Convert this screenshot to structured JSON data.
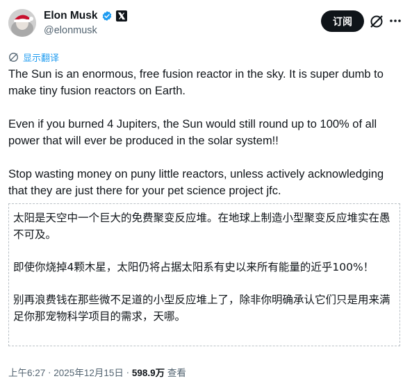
{
  "author": {
    "display_name": "Elon Musk",
    "handle": "@elonmusk"
  },
  "header": {
    "subscribe_label": "订阅"
  },
  "translate": {
    "label": "显示翻译"
  },
  "tweet": {
    "paragraphs": [
      "The Sun is an enormous, free fusion reactor in the sky. It is super dumb to make tiny fusion reactors on Earth.",
      "Even if you burned 4 Jupiters, the Sun would still round up to 100% of all power that will ever be produced in the solar system!!",
      "Stop wasting money on puny little reactors, unless actively acknowledging that they are just there for your pet science project jfc."
    ]
  },
  "translation": {
    "paragraphs": [
      "太阳是天空中一个巨大的免费聚变反应堆。在地球上制造小型聚变反应堆实在愚不可及。",
      "即使你烧掉4颗木星，太阳仍将占据太阳系有史以来所有能量的近乎100%！",
      "别再浪费钱在那些微不足道的小型反应堆上了，除非你明确承认它们只是用来满足你那宠物科学项目的需求，天哪。"
    ]
  },
  "meta": {
    "time": "上午6:27",
    "separator": " · ",
    "date": "2025年12月15日",
    "separator2": " · ",
    "views": "598.9万",
    "views_suffix": " 查看"
  },
  "colors": {
    "link": "#1d9bf0",
    "verified": "#1d9bf0",
    "text": "#0f1419",
    "secondary": "#536471"
  },
  "icons": {
    "verified": "verified-badge-icon",
    "x_logo": "x-logo-icon",
    "grok": "grok-icon",
    "more": "more-icon",
    "translate": "translate-icon"
  }
}
